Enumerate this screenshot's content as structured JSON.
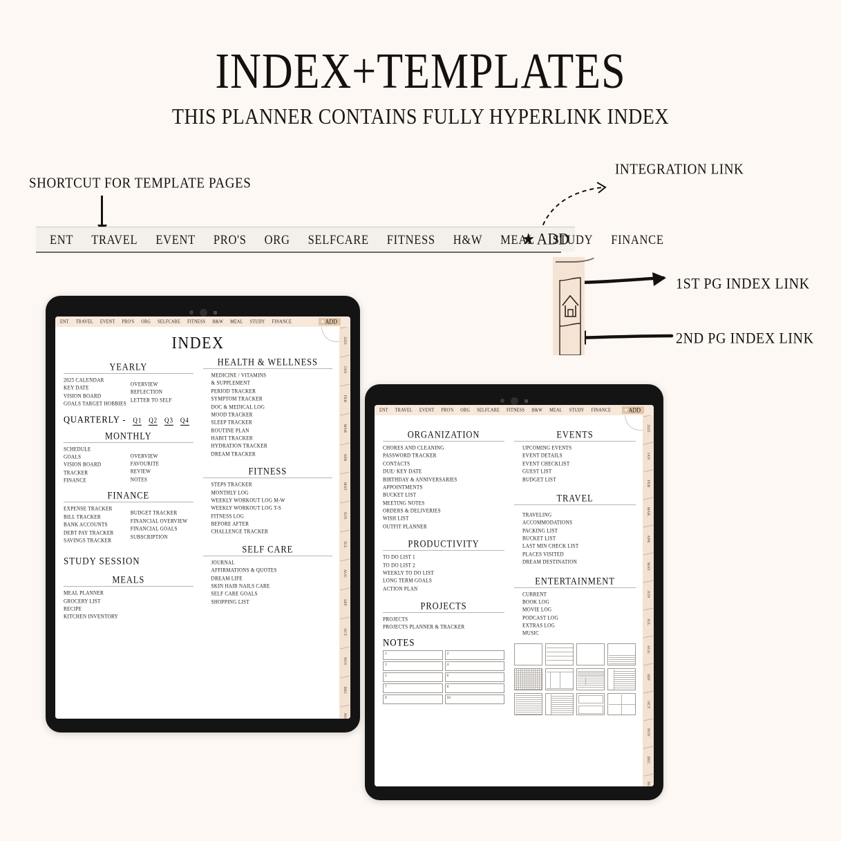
{
  "header": {
    "title": "INDEX+TEMPLATES",
    "subtitle": "THIS PLANNER CONTAINS FULLY HYPERLINK INDEX"
  },
  "annotations": {
    "shortcut": "SHORTCUT FOR TEMPLATE PAGES",
    "integration": "INTEGRATION LINK",
    "index_link_1": "1ST PG INDEX LINK",
    "index_link_2": "2ND PG INDEX LINK"
  },
  "topnav": {
    "items": [
      "ENT",
      "TRAVEL",
      "EVENT",
      "PRO'S",
      "ORG",
      "SELFCARE",
      "FITNESS",
      "H&W",
      "MEAL",
      "STUDY",
      "FINANCE"
    ],
    "add_label": "ADD",
    "star_icon": "★"
  },
  "colors": {
    "background": "#FDF8F3",
    "nav_strip": "#F3F0EC",
    "tablet_nav": "#F7E8DA",
    "add_chip": "#E0C6A9",
    "bookmark": "#F5E3D4",
    "rail": "#F3E2D2",
    "ink": "#15110F"
  },
  "month_rail": [
    "2025",
    "JAN",
    "FEB",
    "MAR",
    "APR",
    "MAY",
    "JUN",
    "JUL",
    "AUG",
    "SEP",
    "OCT",
    "NOV",
    "DEC",
    "NOTES"
  ],
  "tablet1": {
    "page_heading": "INDEX",
    "sections": [
      {
        "title": "YEARLY",
        "layout": "two-column",
        "col_a": [
          "2025 CALENDAR",
          "KEY DATE",
          "VISION BOARD",
          "GOALS TARGET HOBBIES"
        ],
        "col_b": [
          "OVERVIEW",
          "REFLECTION",
          "LETTER TO SELF"
        ]
      },
      {
        "title": "QUARTERLY -",
        "layout": "quarters",
        "quarters": [
          "Q1",
          "Q2",
          "Q3",
          "Q4"
        ]
      },
      {
        "title": "MONTHLY",
        "layout": "two-column",
        "col_a": [
          "SCHEDULE",
          "GOALS",
          "VISION BOARD",
          "TRACKER",
          "FINANCE"
        ],
        "col_b": [
          "OVERVIEW",
          "FAVOURITE",
          "REVIEW",
          "NOTES"
        ]
      },
      {
        "title": "FINANCE",
        "layout": "two-column",
        "col_a": [
          "EXPENSE TRACKER",
          "BILL TRACKER",
          "BANK ACCOUNTS",
          "DEBT PAY TRACKER",
          "SAVINGS TRACKER"
        ],
        "col_b": [
          "BUDGET TRACKER",
          "FINANCIAL OVERVIEW",
          "FINANCIAL GOALS",
          "SUBSCRIPTION"
        ]
      },
      {
        "title": "STUDY SESSION",
        "layout": "heading-only",
        "items": []
      },
      {
        "title": "MEALS",
        "layout": "single",
        "items": [
          "MEAL PLANNER",
          "GROCERY LIST",
          "RECIPE",
          "KITCHEN INVENTORY"
        ]
      }
    ],
    "sections_right": [
      {
        "title": "HEALTH  & WELLNESS",
        "layout": "single",
        "items": [
          "MEDICINE / VITAMINS",
          "& SUPPLEMENT",
          "PERIOD TRACKER",
          "SYMPTOM TRACKER",
          "DOC & MEDICAL LOG",
          "MOOD TRACKER",
          "SLEEP TRACKER",
          "ROUTINE PLAN",
          "HABIT TRACKER",
          "HYDRATION TRACKER",
          "DREAM TRACKER"
        ]
      },
      {
        "title": "FITNESS",
        "layout": "single",
        "items": [
          "STEPS TRACKER",
          "MONTHLY LOG",
          "WEEKLY WORKOUT LOG  M-W",
          "WEEKLY WORKOUT LOG T-S",
          "FITNESS LOG",
          "BEFORE AFTER",
          "CHALLENGE TRACKER"
        ]
      },
      {
        "title": "SELF CARE",
        "layout": "single",
        "items": [
          "JOURNAL",
          "AFFIRMATIONS & QUOTES",
          "DREAM LIFE",
          "SKIN HAIR NAILS CARE",
          "SELF CARE GOALS",
          "SHOPPING LIST"
        ]
      }
    ]
  },
  "tablet2": {
    "sections_left": [
      {
        "title": "ORGANIZATION",
        "items": [
          "CHORES AND CLEANING",
          "PASSWORD TRACKER",
          "CONTACTS",
          "DUE/ KEY DATE",
          "BIRTHDAY & ANNIVERSARIES",
          "APPOINTMENTS",
          "BUCKET LIST",
          "MEETING NOTES",
          "ORDERS & DELIVERIES",
          "WISH LIST",
          "OUTFIT PLANNER"
        ]
      },
      {
        "title": "PRODUCTIVITY",
        "items": [
          "TO DO LIST 1",
          "TO DO LIST 2",
          "WEEKLY TO DO LIST",
          "LONG TERM GOALS",
          "ACTION PLAN"
        ]
      },
      {
        "title": "PROJECTS",
        "items": [
          "PROJECTS",
          "PROJECTS PLANNER & TRACKER"
        ]
      }
    ],
    "sections_right": [
      {
        "title": "EVENTS",
        "items": [
          "UPCOMING EVENTS",
          "EVENT DETAILS",
          "EVENT CHECKLIST",
          "GUEST LIST",
          "BUDGET LIST"
        ]
      },
      {
        "title": "TRAVEL",
        "items": [
          "TRAVELING",
          "ACCOMMODATIONS",
          "PACKING LIST",
          "BUCKET LIST",
          "LAST MIN CHECK LIST",
          "PLACES VISITED",
          "DREAM DESTINATION"
        ]
      },
      {
        "title": "ENTERTAINMENT",
        "items": [
          "CURRENT",
          "BOOK LOG",
          "MOVIE LOG",
          "PODCAST LOG",
          "EXTRAS LOG",
          "MUSIC"
        ]
      }
    ],
    "notes": {
      "title": "NOTES",
      "boxes": [
        "1",
        "2",
        "3",
        "4",
        "5",
        "6",
        "7",
        "8",
        "9",
        "10"
      ]
    },
    "thumbnails": [
      "blank",
      "wide-lines",
      "blank-tall",
      "half-lines",
      "grid",
      "t-chart",
      "lines-divided",
      "lines-left-col",
      "all-lines",
      "sidebar-lines",
      "two-boxes",
      "four-quad"
    ]
  }
}
